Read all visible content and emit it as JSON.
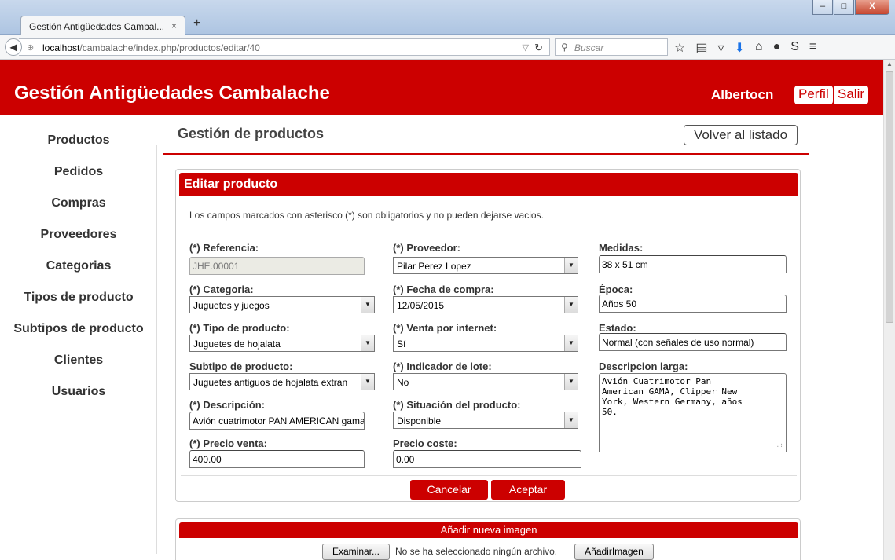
{
  "browser": {
    "tab_title": "Gestión Antigüedades Cambal...",
    "tab_close": "×",
    "new_tab": "+",
    "url_host": "localhost",
    "url_path": "/cambalache/index.php/productos/editar/40",
    "search_placeholder": "Buscar",
    "window_buttons": {
      "minimize": "–",
      "maximize": "□",
      "close": "X"
    }
  },
  "header": {
    "title": "Gestión Antigüedades Cambalache",
    "user": "Albertocn",
    "profile_label": "Perfil",
    "logout_label": "Salir"
  },
  "sidebar": {
    "items": [
      {
        "label": "Productos"
      },
      {
        "label": "Pedidos"
      },
      {
        "label": "Compras"
      },
      {
        "label": "Proveedores"
      },
      {
        "label": "Categorias"
      },
      {
        "label": "Tipos de producto"
      },
      {
        "label": "Subtipos de producto"
      },
      {
        "label": "Clientes"
      },
      {
        "label": "Usuarios"
      }
    ]
  },
  "main": {
    "section_title": "Gestión de productos",
    "back_label": "Volver al listado",
    "panel_title": "Editar producto",
    "note": "Los campos marcados con asterisco (*) son obligatorios y no pueden dejarse vacios."
  },
  "form": {
    "referencia": {
      "label": "(*) Referencia:",
      "value": "JHE.00001"
    },
    "categoria": {
      "label": "(*) Categoria:",
      "value": "Juguetes y juegos"
    },
    "tipo": {
      "label": "(*) Tipo de producto:",
      "value": "Juguetes de hojalata"
    },
    "subtipo": {
      "label": "Subtipo de producto:",
      "value": "Juguetes antiguos de hojalata extran"
    },
    "descripcion": {
      "label": "(*) Descripción:",
      "value": "Avión cuatrimotor PAN AMERICAN gama"
    },
    "precio_venta": {
      "label": "(*) Precio venta:",
      "value": "400.00"
    },
    "proveedor": {
      "label": "(*) Proveedor:",
      "value": "Pilar Perez Lopez"
    },
    "fecha_compra": {
      "label": "(*) Fecha de compra:",
      "value": "12/05/2015"
    },
    "venta_internet": {
      "label": "(*) Venta por internet:",
      "value": "Sí"
    },
    "indicador_lote": {
      "label": "(*) Indicador de lote:",
      "value": "No"
    },
    "situacion": {
      "label": "(*) Situación del producto:",
      "value": "Disponible"
    },
    "precio_coste": {
      "label": "Precio coste:",
      "value": "0.00"
    },
    "medidas": {
      "label": "Medidas:",
      "value": "38 x 51 cm"
    },
    "epoca": {
      "label": "Época:",
      "value": "Años 50"
    },
    "estado": {
      "label": "Estado:",
      "value": "Normal (con señales de uso normal)"
    },
    "descripcion_larga": {
      "label": "Descripcion larga:",
      "lines": [
        "Avión Cuatrimotor Pan",
        "American GAMA, Clipper New",
        "York, Western Germany, años",
        "50."
      ]
    },
    "cancel_label": "Cancelar",
    "accept_label": "Aceptar"
  },
  "image_panel": {
    "title": "Añadir nueva imagen",
    "browse_label": "Examinar...",
    "no_file_text": "No se ha seleccionado ningún archivo.",
    "add_label": "AñadirImagen"
  }
}
